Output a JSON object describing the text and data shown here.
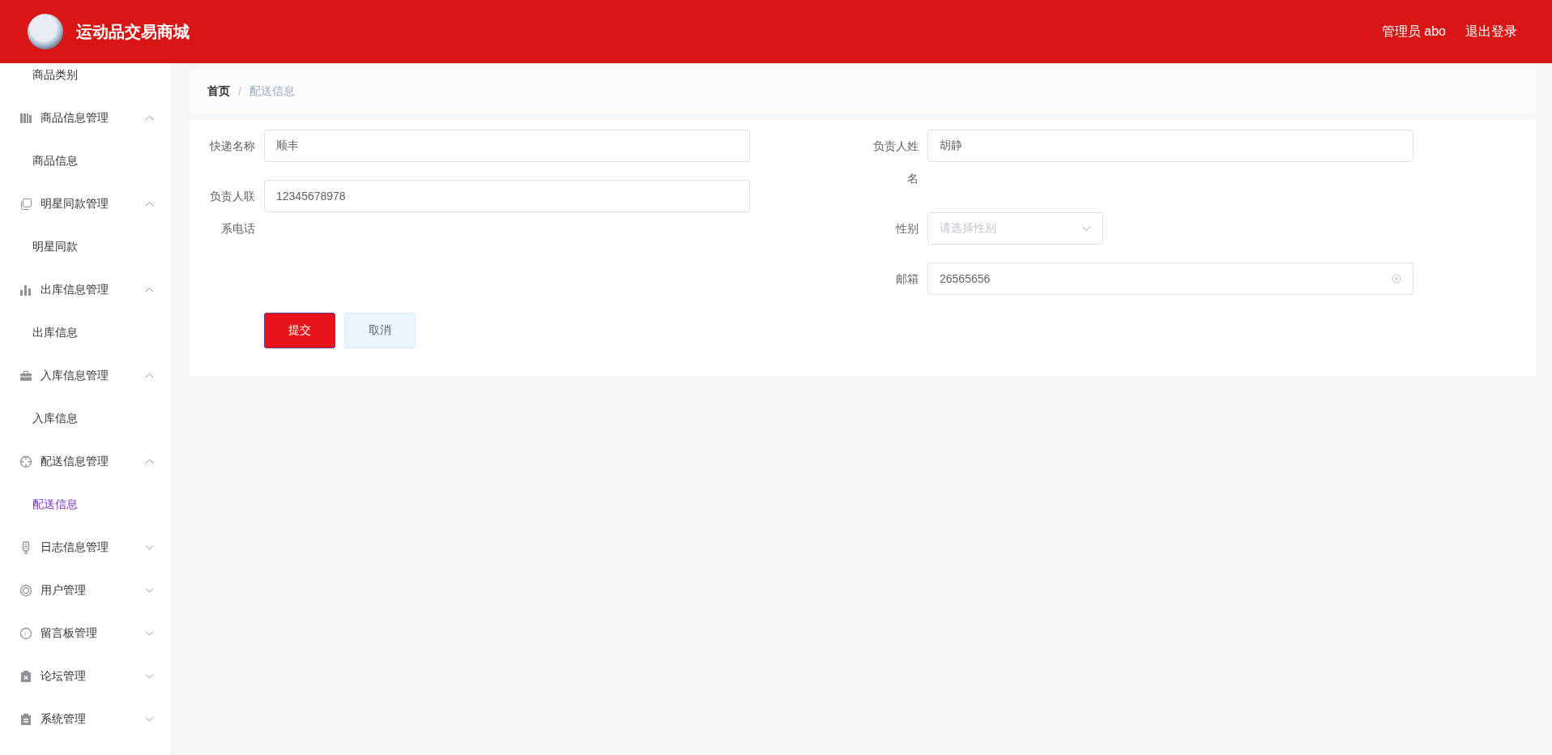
{
  "header": {
    "title": "运动品交易商城",
    "user": "管理员 abo",
    "logout": "退出登录"
  },
  "sidebar": {
    "items": [
      {
        "kind": "sub",
        "label": "商品类别",
        "selected": false
      },
      {
        "kind": "group",
        "label": "商品信息管理",
        "expanded": true,
        "children": [
          {
            "label": "商品信息",
            "selected": false
          }
        ]
      },
      {
        "kind": "group",
        "label": "明星同款管理",
        "expanded": true,
        "children": [
          {
            "label": "明星同款",
            "selected": false
          }
        ]
      },
      {
        "kind": "group",
        "label": "出库信息管理",
        "expanded": true,
        "children": [
          {
            "label": "出库信息",
            "selected": false
          }
        ]
      },
      {
        "kind": "group",
        "label": "入库信息管理",
        "expanded": true,
        "children": [
          {
            "label": "入库信息",
            "selected": false
          }
        ]
      },
      {
        "kind": "group",
        "label": "配送信息管理",
        "expanded": true,
        "children": [
          {
            "label": "配送信息",
            "selected": true
          }
        ]
      },
      {
        "kind": "group",
        "label": "日志信息管理",
        "expanded": false
      },
      {
        "kind": "group",
        "label": "用户管理",
        "expanded": false
      },
      {
        "kind": "group",
        "label": "留言板管理",
        "expanded": false
      },
      {
        "kind": "group",
        "label": "论坛管理",
        "expanded": false
      },
      {
        "kind": "group",
        "label": "系统管理",
        "expanded": false
      }
    ]
  },
  "breadcrumb": {
    "items": [
      "首页",
      "配送信息"
    ],
    "separator": "/"
  },
  "form": {
    "columns": [
      [
        {
          "kind": "input",
          "label": "快递名称",
          "value": "顺丰"
        },
        {
          "kind": "input",
          "label": "负责人联系电话",
          "value": "12345678978"
        }
      ],
      [
        {
          "kind": "input",
          "label": "负责人姓名",
          "value": "胡静"
        },
        {
          "kind": "select",
          "label": "性别",
          "placeholder": "请选择性别"
        },
        {
          "kind": "input",
          "label": "邮箱",
          "value": "26565656",
          "clearable": true
        }
      ]
    ],
    "buttons": [
      {
        "kind": "primary",
        "label": "提交"
      },
      {
        "kind": "default",
        "label": "取消"
      }
    ]
  }
}
